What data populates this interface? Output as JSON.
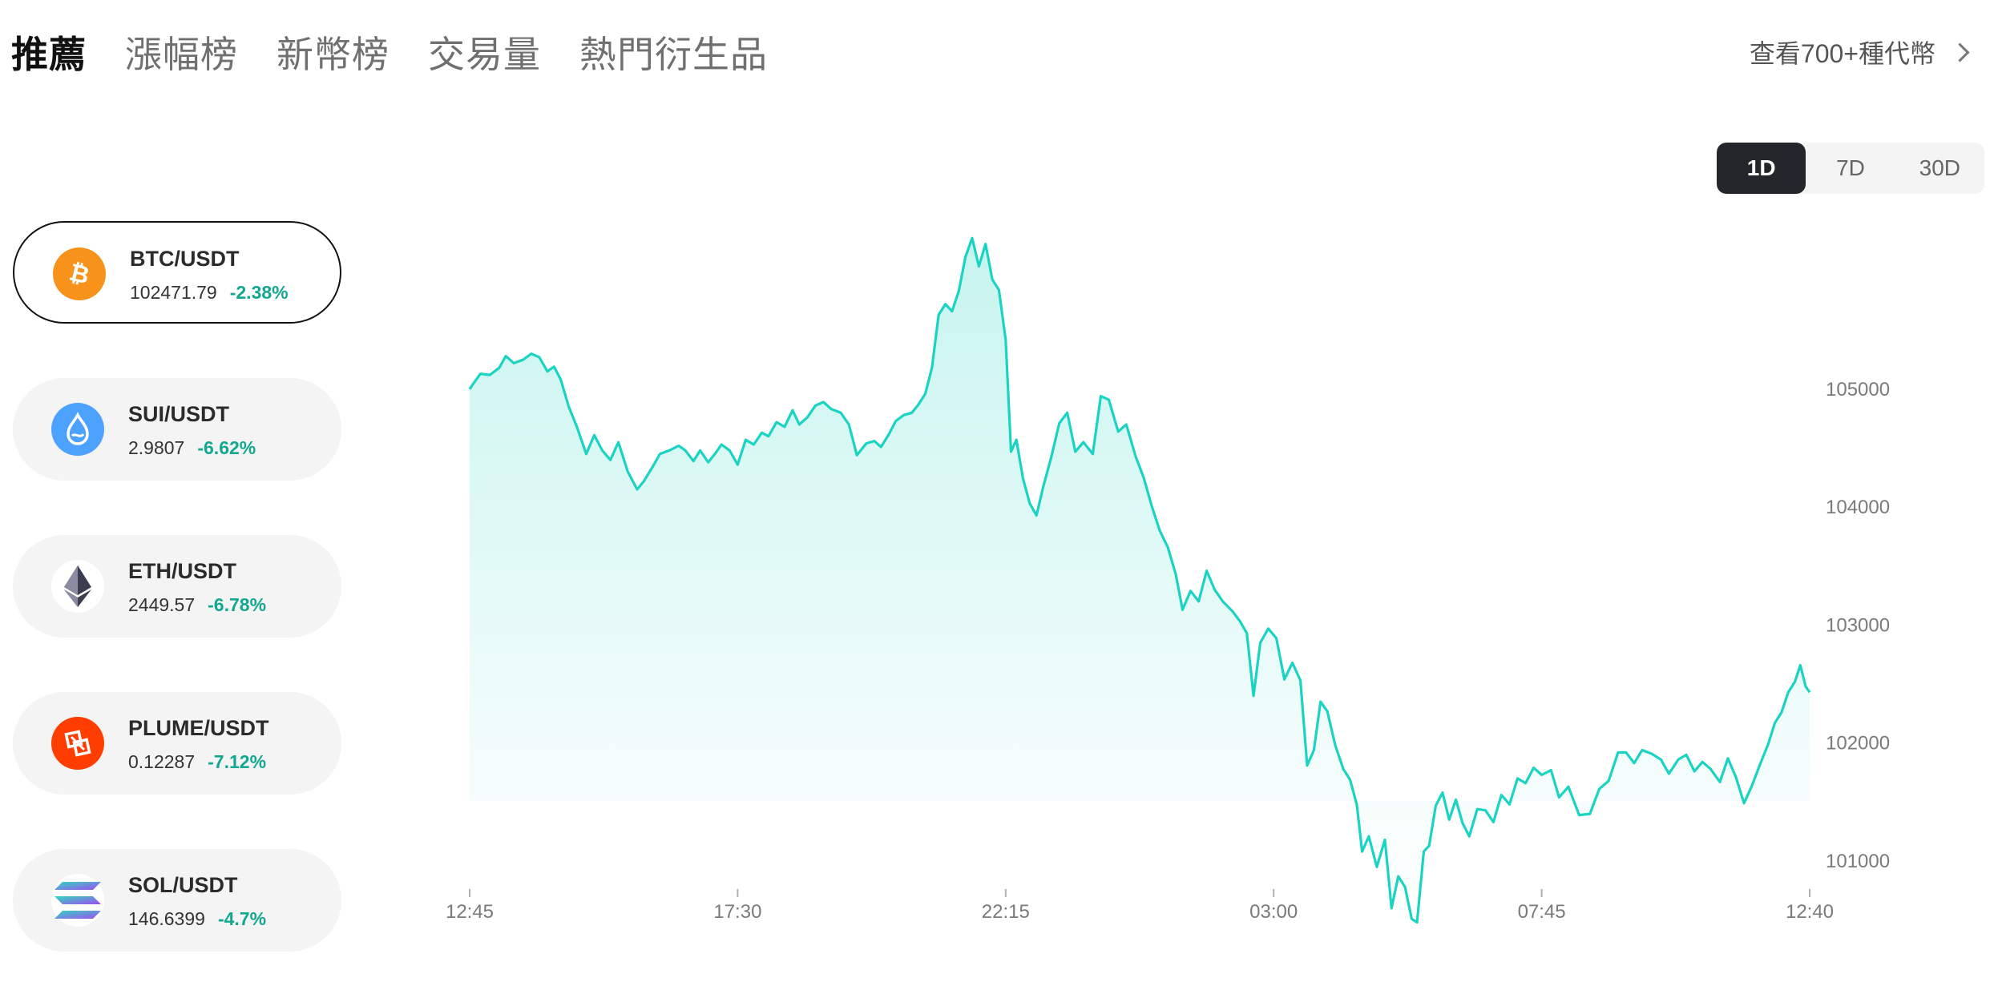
{
  "tabs": [
    {
      "label": "推薦",
      "active": true
    },
    {
      "label": "漲幅榜",
      "active": false
    },
    {
      "label": "新幣榜",
      "active": false
    },
    {
      "label": "交易量",
      "active": false
    },
    {
      "label": "熱門衍生品",
      "active": false
    }
  ],
  "view_all": {
    "label": "查看700+種代幣"
  },
  "range": {
    "options": [
      "1D",
      "7D",
      "30D"
    ],
    "selected": "1D"
  },
  "coins": [
    {
      "pair": "BTC/USDT",
      "price": "102471.79",
      "change": "-2.38%",
      "icon": "bitcoin-icon",
      "active": true
    },
    {
      "pair": "SUI/USDT",
      "price": "2.9807",
      "change": "-6.62%",
      "icon": "sui-icon",
      "active": false
    },
    {
      "pair": "ETH/USDT",
      "price": "2449.57",
      "change": "-6.78%",
      "icon": "ethereum-icon",
      "active": false
    },
    {
      "pair": "PLUME/USDT",
      "price": "0.12287",
      "change": "-7.12%",
      "icon": "plume-icon",
      "active": false
    },
    {
      "pair": "SOL/USDT",
      "price": "146.6399",
      "change": "-4.7%",
      "icon": "solana-icon",
      "active": false
    }
  ],
  "colors": {
    "accent": "#1bd3c3",
    "negative": "#12a88f",
    "bitcoin": "#f7931a",
    "sui": "#4da2ff",
    "plume": "#ff3d00"
  },
  "chart_data": {
    "type": "area",
    "series": [
      {
        "pair": "BTC/USDT"
      }
    ],
    "x_labels": [
      "12:45",
      "17:30",
      "22:15",
      "03:00",
      "07:45",
      "12:40"
    ],
    "y_ticks": [
      101000,
      102000,
      103000,
      104000,
      105000
    ],
    "ylim": [
      100500,
      106000
    ],
    "grid": false,
    "points": [
      [
        0,
        105000
      ],
      [
        0.003,
        105050
      ],
      [
        0.008,
        105130
      ],
      [
        0.015,
        105120
      ],
      [
        0.022,
        105180
      ],
      [
        0.027,
        105280
      ],
      [
        0.033,
        105220
      ],
      [
        0.04,
        105250
      ],
      [
        0.046,
        105300
      ],
      [
        0.052,
        105270
      ],
      [
        0.058,
        105150
      ],
      [
        0.063,
        105190
      ],
      [
        0.068,
        105080
      ],
      [
        0.074,
        104850
      ],
      [
        0.08,
        104680
      ],
      [
        0.087,
        104450
      ],
      [
        0.093,
        104610
      ],
      [
        0.099,
        104480
      ],
      [
        0.105,
        104400
      ],
      [
        0.111,
        104550
      ],
      [
        0.118,
        104300
      ],
      [
        0.125,
        104150
      ],
      [
        0.13,
        104220
      ],
      [
        0.137,
        104350
      ],
      [
        0.142,
        104450
      ],
      [
        0.149,
        104480
      ],
      [
        0.156,
        104520
      ],
      [
        0.161,
        104480
      ],
      [
        0.167,
        104390
      ],
      [
        0.172,
        104480
      ],
      [
        0.178,
        104380
      ],
      [
        0.183,
        104450
      ],
      [
        0.188,
        104530
      ],
      [
        0.194,
        104480
      ],
      [
        0.2,
        104360
      ],
      [
        0.206,
        104570
      ],
      [
        0.212,
        104530
      ],
      [
        0.218,
        104630
      ],
      [
        0.223,
        104600
      ],
      [
        0.229,
        104720
      ],
      [
        0.235,
        104680
      ],
      [
        0.241,
        104820
      ],
      [
        0.246,
        104700
      ],
      [
        0.252,
        104760
      ],
      [
        0.258,
        104860
      ],
      [
        0.264,
        104890
      ],
      [
        0.27,
        104830
      ],
      [
        0.277,
        104800
      ],
      [
        0.283,
        104700
      ],
      [
        0.289,
        104440
      ],
      [
        0.296,
        104540
      ],
      [
        0.302,
        104560
      ],
      [
        0.307,
        104510
      ],
      [
        0.313,
        104620
      ],
      [
        0.318,
        104730
      ],
      [
        0.324,
        104780
      ],
      [
        0.33,
        104800
      ],
      [
        0.335,
        104870
      ],
      [
        0.34,
        104960
      ],
      [
        0.345,
        105180
      ],
      [
        0.35,
        105630
      ],
      [
        0.355,
        105720
      ],
      [
        0.36,
        105660
      ],
      [
        0.365,
        105830
      ],
      [
        0.37,
        106120
      ],
      [
        0.375,
        106280
      ],
      [
        0.38,
        106040
      ],
      [
        0.385,
        106230
      ],
      [
        0.39,
        105930
      ],
      [
        0.395,
        105840
      ],
      [
        0.4,
        105420
      ],
      [
        0.404,
        104470
      ],
      [
        0.408,
        104570
      ],
      [
        0.413,
        104240
      ],
      [
        0.418,
        104030
      ],
      [
        0.423,
        103930
      ],
      [
        0.428,
        104170
      ],
      [
        0.434,
        104420
      ],
      [
        0.44,
        104710
      ],
      [
        0.446,
        104800
      ],
      [
        0.452,
        104470
      ],
      [
        0.458,
        104550
      ],
      [
        0.465,
        104450
      ],
      [
        0.471,
        104940
      ],
      [
        0.477,
        104910
      ],
      [
        0.484,
        104640
      ],
      [
        0.49,
        104700
      ],
      [
        0.497,
        104430
      ],
      [
        0.503,
        104250
      ],
      [
        0.509,
        104010
      ],
      [
        0.515,
        103800
      ],
      [
        0.521,
        103660
      ],
      [
        0.527,
        103430
      ],
      [
        0.532,
        103130
      ],
      [
        0.538,
        103290
      ],
      [
        0.544,
        103200
      ],
      [
        0.55,
        103460
      ],
      [
        0.556,
        103300
      ],
      [
        0.562,
        103200
      ],
      [
        0.569,
        103120
      ],
      [
        0.575,
        103030
      ],
      [
        0.58,
        102930
      ],
      [
        0.585,
        102400
      ],
      [
        0.59,
        102850
      ],
      [
        0.596,
        102970
      ],
      [
        0.602,
        102890
      ],
      [
        0.608,
        102540
      ],
      [
        0.614,
        102680
      ],
      [
        0.62,
        102530
      ],
      [
        0.625,
        101810
      ],
      [
        0.63,
        101940
      ],
      [
        0.635,
        102350
      ],
      [
        0.64,
        102270
      ],
      [
        0.646,
        101980
      ],
      [
        0.652,
        101780
      ],
      [
        0.657,
        101690
      ],
      [
        0.662,
        101480
      ],
      [
        0.666,
        101080
      ],
      [
        0.671,
        101210
      ],
      [
        0.677,
        100950
      ],
      [
        0.683,
        101180
      ],
      [
        0.688,
        100600
      ],
      [
        0.693,
        100870
      ],
      [
        0.698,
        100780
      ],
      [
        0.703,
        100510
      ],
      [
        0.707,
        100480
      ],
      [
        0.712,
        101080
      ],
      [
        0.716,
        101130
      ],
      [
        0.721,
        101470
      ],
      [
        0.726,
        101580
      ],
      [
        0.731,
        101350
      ],
      [
        0.736,
        101520
      ],
      [
        0.741,
        101320
      ],
      [
        0.746,
        101210
      ],
      [
        0.752,
        101440
      ],
      [
        0.758,
        101430
      ],
      [
        0.764,
        101330
      ],
      [
        0.77,
        101560
      ],
      [
        0.776,
        101480
      ],
      [
        0.782,
        101700
      ],
      [
        0.788,
        101660
      ],
      [
        0.794,
        101790
      ],
      [
        0.8,
        101730
      ],
      [
        0.807,
        101770
      ],
      [
        0.813,
        101540
      ],
      [
        0.82,
        101630
      ],
      [
        0.828,
        101390
      ],
      [
        0.836,
        101400
      ],
      [
        0.843,
        101610
      ],
      [
        0.85,
        101680
      ],
      [
        0.857,
        101920
      ],
      [
        0.863,
        101920
      ],
      [
        0.869,
        101830
      ],
      [
        0.875,
        101940
      ],
      [
        0.882,
        101910
      ],
      [
        0.889,
        101860
      ],
      [
        0.895,
        101740
      ],
      [
        0.902,
        101860
      ],
      [
        0.908,
        101900
      ],
      [
        0.914,
        101760
      ],
      [
        0.92,
        101840
      ],
      [
        0.926,
        101780
      ],
      [
        0.933,
        101670
      ],
      [
        0.939,
        101870
      ],
      [
        0.945,
        101710
      ],
      [
        0.951,
        101490
      ],
      [
        0.957,
        101640
      ],
      [
        0.963,
        101820
      ],
      [
        0.969,
        101990
      ],
      [
        0.974,
        102170
      ],
      [
        0.979,
        102260
      ],
      [
        0.984,
        102430
      ],
      [
        0.989,
        102520
      ],
      [
        0.993,
        102660
      ],
      [
        0.997,
        102480
      ],
      [
        1.0,
        102430
      ]
    ]
  }
}
